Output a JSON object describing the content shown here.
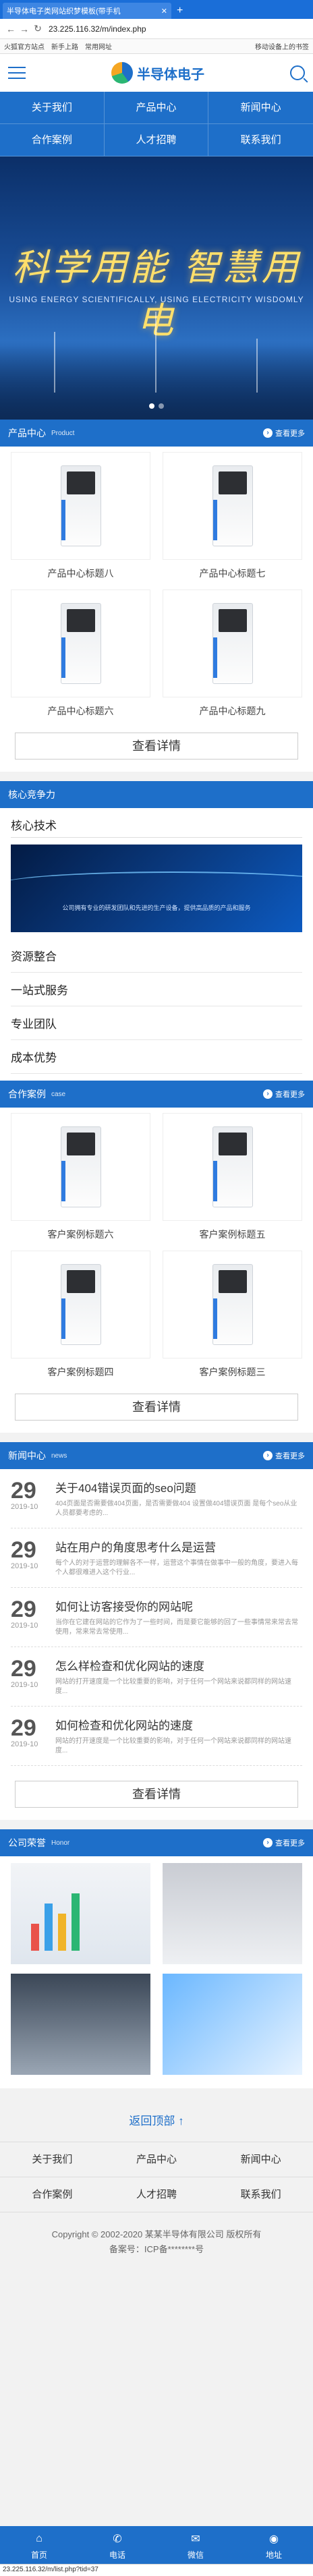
{
  "browser": {
    "tab_title": "半导体电子类网站织梦模板(带手机",
    "url": "23.225.116.32/m/index.php",
    "bookmarks": [
      "火狐官方站点",
      "新手上路",
      "常用网址",
      "移动设备上的书签"
    ]
  },
  "header": {
    "logo_text": "半导体电子"
  },
  "nav": [
    "关于我们",
    "产品中心",
    "新闻中心",
    "合作案例",
    "人才招聘",
    "联系我们"
  ],
  "banner": {
    "title": "科学用能 智慧用电",
    "subtitle": "USING ENERGY SCIENTIFICALLY, USING ELECTRICITY WISDOMLY"
  },
  "products": {
    "title": "产品中心",
    "en": "Product",
    "more": "查看更多",
    "items": [
      "产品中心标题八",
      "产品中心标题七",
      "产品中心标题六",
      "产品中心标题九"
    ],
    "detail": "查看详情"
  },
  "core": {
    "title": "核心竞争力",
    "first": "核心技术",
    "caption": "公司拥有专业的研发团队和先进的生产设备，提供高品质的产品和服务",
    "items": [
      "资源整合",
      "一站式服务",
      "专业团队",
      "成本优势"
    ]
  },
  "cases": {
    "title": "合作案例",
    "en": "case",
    "more": "查看更多",
    "items": [
      "客户案例标题六",
      "客户案例标题五",
      "客户案例标题四",
      "客户案例标题三"
    ],
    "detail": "查看详情"
  },
  "news": {
    "title": "新闻中心",
    "en": "news",
    "more": "查看更多",
    "items": [
      {
        "day": "29",
        "ym": "2019-10",
        "title": "关于404错误页面的seo问题",
        "desc": "404页面是否需要做404页面，是否需要做404 设置做404错误页面 是每个seo从业人员都要考虑的..."
      },
      {
        "day": "29",
        "ym": "2019-10",
        "title": "站在用户的角度思考什么是运营",
        "desc": "每个人的对于运营的理解各不一样，运营这个事情在做事中一般的角度，要进入每个人都很难进入这个行业..."
      },
      {
        "day": "29",
        "ym": "2019-10",
        "title": "如何让访客接受你的网站呢",
        "desc": "当你在它建在网站的它作为了一些时间，而是要它能够的回了一些事情常来常去常使用，常来常去常使用..."
      },
      {
        "day": "29",
        "ym": "2019-10",
        "title": "怎么样检查和优化网站的速度",
        "desc": "网站的打开速度是一个比较重要的影响，对于任何一个网站来说都同样的网站速度..."
      },
      {
        "day": "29",
        "ym": "2019-10",
        "title": "如何检查和优化网站的速度",
        "desc": "网站的打开速度是一个比较重要的影响，对于任何一个网站来说都同样的网站速度..."
      }
    ],
    "detail": "查看详情"
  },
  "honor": {
    "title": "公司荣誉",
    "en": "Honor",
    "more": "查看更多"
  },
  "footer": {
    "back_top": "返回顶部 ↑",
    "nav": [
      "关于我们",
      "产品中心",
      "新闻中心",
      "合作案例",
      "人才招聘",
      "联系我们"
    ],
    "copyright": "Copyright © 2002-2020 某某半导体有限公司 版权所有",
    "icp": "备案号：ICP备********号"
  },
  "bottom_bar": [
    "首页",
    "电话",
    "微信",
    "地址"
  ],
  "status_url": "23.225.116.32/m/list.php?tid=37",
  "colors": {
    "brand": "#1e6fc9"
  }
}
